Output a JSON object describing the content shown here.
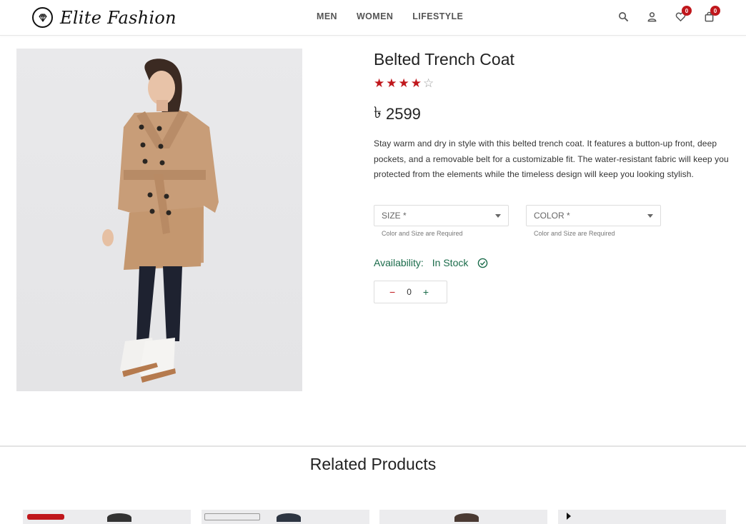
{
  "header": {
    "logo_text": "Elite Fashion",
    "nav": [
      "MEN",
      "WOMEN",
      "LIFESTYLE"
    ],
    "wishlist_count": "0",
    "cart_count": "0",
    "icons": [
      "search-icon",
      "user-icon",
      "heart-icon",
      "bag-icon"
    ]
  },
  "product": {
    "title": "Belted Trench Coat",
    "rating": 4,
    "rating_max": 5,
    "currency_symbol": "৳",
    "price": "2599",
    "description": "Stay warm and dry in style with this belted trench coat. It features a button-up front, deep pockets, and a removable belt for a customizable fit. The water-resistant fabric will keep you protected from the elements while the timeless design will keep you looking stylish.",
    "size_placeholder": "SIZE *",
    "color_placeholder": "COLOR *",
    "size_helper": "Color and Size are Required",
    "color_helper": "Color and Size are Required",
    "availability_label": "Availability:",
    "availability_value": "In Stock",
    "quantity": "0",
    "minus_label": "−",
    "plus_label": "+"
  },
  "related": {
    "title": "Related Products"
  },
  "colors": {
    "accent_red": "#c0171c",
    "stock_green": "#1a6b4a"
  }
}
